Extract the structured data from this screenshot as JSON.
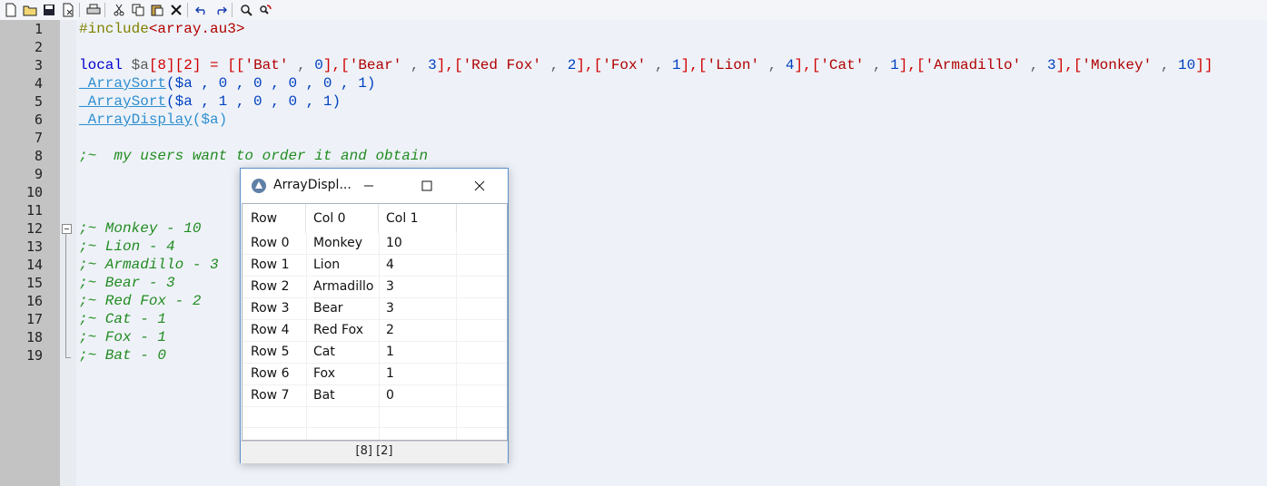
{
  "toolbar": {
    "buttons": [
      "new-file-icon",
      "open-folder-icon",
      "save-icon",
      "close-file-icon",
      "print-icon",
      "cut-icon",
      "copy-icon",
      "paste-icon",
      "delete-icon",
      "undo-icon",
      "redo-icon",
      "find-icon",
      "replace-icon"
    ]
  },
  "editor": {
    "line_numbers": [
      "1",
      "2",
      "3",
      "4",
      "5",
      "6",
      "7",
      "8",
      "9",
      "10",
      "11",
      "12",
      "13",
      "14",
      "15",
      "16",
      "17",
      "18",
      "19"
    ],
    "line1": {
      "directive": "#include",
      "path": "<array.au3>"
    },
    "line3": {
      "kw": "local",
      "var": "$a",
      "b1": "[8]",
      "b2": "[2]",
      "eq": " = ",
      "open": "[[",
      "items": [
        {
          "s": "'Bat'",
          "n": "0"
        },
        {
          "s": "'Bear'",
          "n": "3"
        },
        {
          "s": "'Red Fox'",
          "n": "2"
        },
        {
          "s": "'Fox'",
          "n": "1"
        },
        {
          "s": "'Lion'",
          "n": "4"
        },
        {
          "s": "'Cat'",
          "n": "1"
        },
        {
          "s": "'Armadillo'",
          "n": "3"
        },
        {
          "s": "'Monkey'",
          "n": "10"
        }
      ]
    },
    "line4": {
      "fn": "_ArraySort",
      "args": "($a , 0 , 0 , 0 , 0 , 1)"
    },
    "line5": {
      "fn": "_ArraySort",
      "args": "($a , 1 , 0 , 0 , 1)"
    },
    "line6": {
      "fn": "_ArrayDisplay",
      "args": "($a)"
    },
    "line8": ";~  my users want to order it and obtain",
    "comments": [
      ";~ Monkey - 10",
      ";~ Lion - 4",
      ";~ Armadillo - 3",
      ";~ Bear - 3",
      ";~ Red Fox - 2",
      ";~ Cat - 1",
      ";~ Fox - 1",
      ";~ Bat - 0"
    ]
  },
  "dialog": {
    "title": "ArrayDispl...",
    "headers": [
      "Row",
      "Col 0",
      "Col 1"
    ],
    "rows": [
      [
        "Row 0",
        "Monkey",
        "10"
      ],
      [
        "Row 1",
        "Lion",
        "4"
      ],
      [
        "Row 2",
        "Armadillo",
        "3"
      ],
      [
        "Row 3",
        "Bear",
        "3"
      ],
      [
        "Row 4",
        "Red Fox",
        "2"
      ],
      [
        "Row 5",
        "Cat",
        "1"
      ],
      [
        "Row 6",
        "Fox",
        "1"
      ],
      [
        "Row 7",
        "Bat",
        "0"
      ]
    ],
    "status": "[8] [2]"
  }
}
